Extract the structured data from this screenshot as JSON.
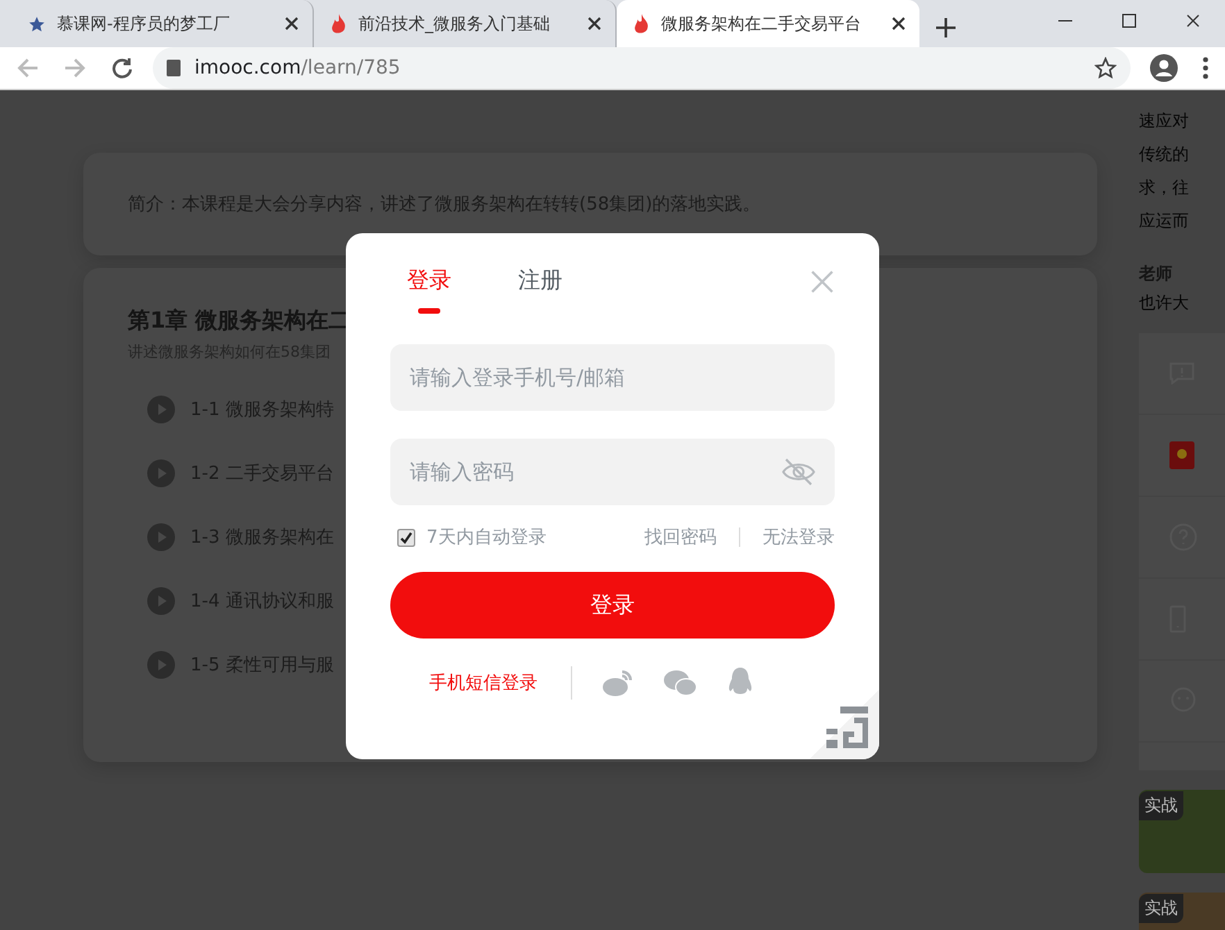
{
  "browser": {
    "tabs": [
      {
        "title": "慕课网-程序员的梦工厂",
        "selected": false,
        "kind": "star"
      },
      {
        "title": "前沿技术_微服务入门基础",
        "selected": false,
        "kind": "flame"
      },
      {
        "title": "微服务架构在二手交易平台",
        "selected": true,
        "kind": "flame"
      }
    ],
    "url": {
      "host": "imooc.com",
      "path": "/learn/785"
    }
  },
  "page": {
    "intro": "简介：本课程是大会分享内容，讲述了微服务架构在转转(58集团)的落地实践。",
    "chapter": {
      "title": "第1章 微服务架构在二",
      "description": "讲述微服务架构如何在58集团",
      "lessons": [
        "1-1 微服务架构特",
        "1-2 二手交易平台",
        "1-3 微服务架构在",
        "1-4 通讯协议和服",
        "1-5 柔性可用与服"
      ]
    },
    "sidebar": {
      "lines": [
        "速应对",
        "传统的",
        "求，往",
        "应运而"
      ],
      "teacher_heading": "老师",
      "teacher_text": "也许大",
      "cards": [
        {
          "tag": "实战"
        },
        {
          "tag": "实战"
        }
      ]
    }
  },
  "login": {
    "tabs": [
      {
        "label": "登录",
        "selected": true
      },
      {
        "label": "注册",
        "selected": false
      }
    ],
    "account_placeholder": "请输入登录手机号/邮箱",
    "password_placeholder": "请输入密码",
    "remember": {
      "label": "7天内自动登录",
      "checked": true
    },
    "links": [
      "找回密码",
      "无法登录"
    ],
    "submit": "登录",
    "sms_login": "手机短信登录"
  }
}
